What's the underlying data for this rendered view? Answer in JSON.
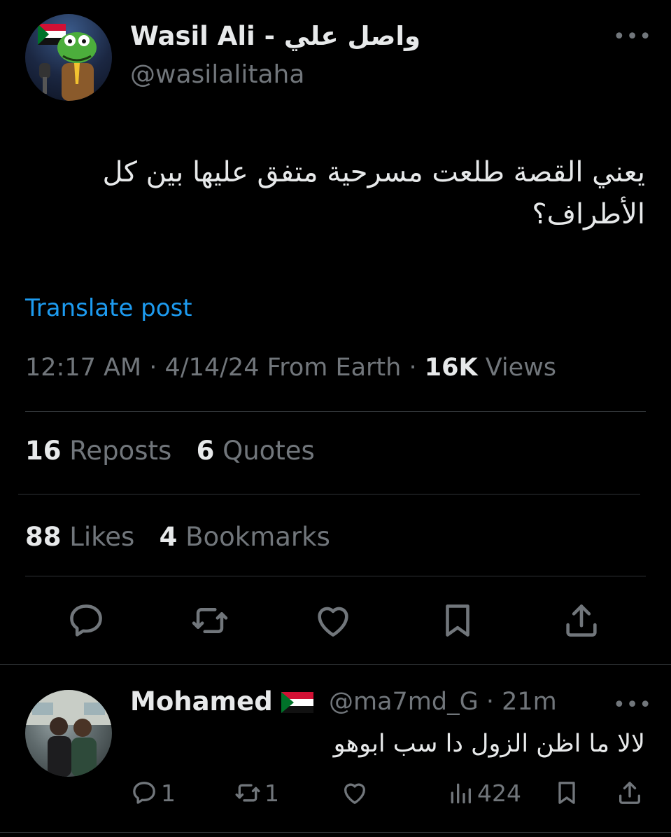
{
  "post": {
    "author": {
      "display_name": "Wasil Ali - واصل علي",
      "handle": "@wasilalitaha"
    },
    "text": "يعني القصة طلعت مسرحية متفق عليها بين كل الأطراف؟",
    "translate_label": "Translate post",
    "meta": {
      "time": "12:17 AM",
      "date": "4/14/24",
      "source": "From Earth",
      "views_count": "16K",
      "views_label": "Views"
    },
    "stats": {
      "reposts_count": "16",
      "reposts_label": "Reposts",
      "quotes_count": "6",
      "quotes_label": "Quotes",
      "likes_count": "88",
      "likes_label": "Likes",
      "bookmarks_count": "4",
      "bookmarks_label": "Bookmarks"
    },
    "actions": [
      "reply-icon",
      "repost-icon",
      "like-icon",
      "bookmark-icon",
      "share-icon"
    ]
  },
  "reply": {
    "display_name": "Mohamed",
    "flag": "sudan-flag",
    "handle": "@ma7md_G",
    "time": "21m",
    "text": "لالا ما اظن الزول دا سب ابوهو",
    "reply_count": "1",
    "repost_count": "1",
    "views_count": "424"
  },
  "colors": {
    "background": "#000000",
    "text_primary": "#e7e9ea",
    "text_secondary": "#71767b",
    "link": "#1d9bf0",
    "divider": "#2f3336"
  }
}
